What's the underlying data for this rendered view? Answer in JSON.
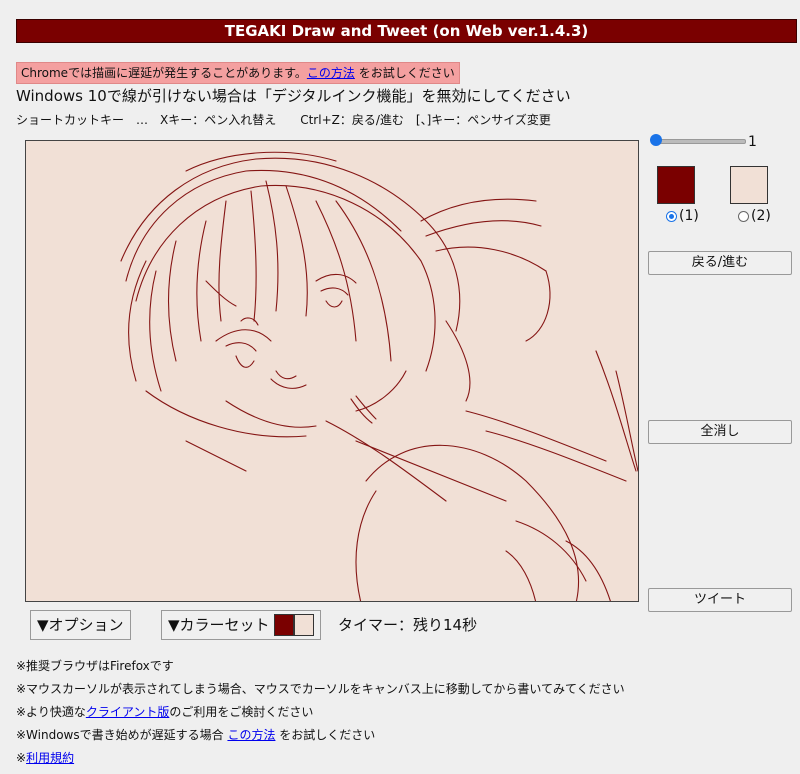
{
  "header": {
    "title": "TEGAKI Draw and Tweet (on Web ver.1.4.3)"
  },
  "notice": {
    "prefix": "Chromeでは描画に遅延が発生することがあります。",
    "link": "この方法",
    "suffix": " をお試しください",
    "windows_ink": "Windows 10で線が引けない場合は「デジタルインク機能」を無効にしてください",
    "shortcuts": "ショートカットキー　…　Xキー：ペン入れ替え　　Ctrl+Z：戻る/進む　[、]キー：ペンサイズ変更"
  },
  "pen": {
    "size_value": "1",
    "size_level": 0.0
  },
  "colors": {
    "color1": "#7a0000",
    "color2": "#f1e0d6",
    "radio1_label": "(1)",
    "radio2_label": "(2)",
    "selected": "(1)"
  },
  "buttons": {
    "undo_redo": "戻る/進む",
    "clear_all": "全消し",
    "tweet": "ツイート"
  },
  "options": {
    "option_label": "▼オプション",
    "colorset_label": "▼カラーセット"
  },
  "timer": {
    "text": "タイマー：残り14秒"
  },
  "footer": {
    "line1": "※推奨ブラウザはFirefoxです",
    "line2": "※マウスカーソルが表示されてしまう場合、マウスでカーソルをキャンバス上に移動してから書いてみてください",
    "line3_prefix": "※より快適な",
    "line3_link": "クライアント版",
    "line3_suffix": "のご利用をご検討ください",
    "line4_prefix": "※Windowsで書き始めが遅延する場合 ",
    "line4_link": "この方法",
    "line4_suffix": " をお試しください",
    "line5_prefix": "※",
    "line5_link": "利用規約"
  },
  "icons": {
    "canvas": "sketch-drawing"
  }
}
